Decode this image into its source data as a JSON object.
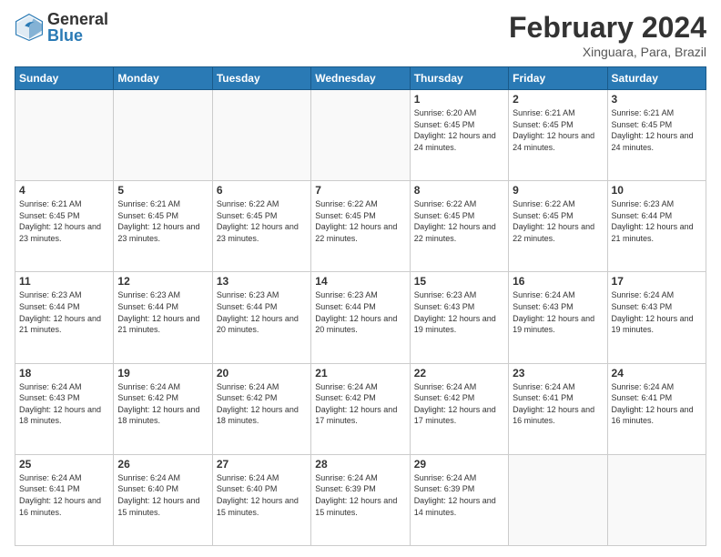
{
  "logo": {
    "general": "General",
    "blue": "Blue"
  },
  "title": {
    "month_year": "February 2024",
    "location": "Xinguara, Para, Brazil"
  },
  "weekdays": [
    "Sunday",
    "Monday",
    "Tuesday",
    "Wednesday",
    "Thursday",
    "Friday",
    "Saturday"
  ],
  "weeks": [
    [
      {
        "day": "",
        "info": ""
      },
      {
        "day": "",
        "info": ""
      },
      {
        "day": "",
        "info": ""
      },
      {
        "day": "",
        "info": ""
      },
      {
        "day": "1",
        "info": "Sunrise: 6:20 AM\nSunset: 6:45 PM\nDaylight: 12 hours and 24 minutes."
      },
      {
        "day": "2",
        "info": "Sunrise: 6:21 AM\nSunset: 6:45 PM\nDaylight: 12 hours and 24 minutes."
      },
      {
        "day": "3",
        "info": "Sunrise: 6:21 AM\nSunset: 6:45 PM\nDaylight: 12 hours and 24 minutes."
      }
    ],
    [
      {
        "day": "4",
        "info": "Sunrise: 6:21 AM\nSunset: 6:45 PM\nDaylight: 12 hours and 23 minutes."
      },
      {
        "day": "5",
        "info": "Sunrise: 6:21 AM\nSunset: 6:45 PM\nDaylight: 12 hours and 23 minutes."
      },
      {
        "day": "6",
        "info": "Sunrise: 6:22 AM\nSunset: 6:45 PM\nDaylight: 12 hours and 23 minutes."
      },
      {
        "day": "7",
        "info": "Sunrise: 6:22 AM\nSunset: 6:45 PM\nDaylight: 12 hours and 22 minutes."
      },
      {
        "day": "8",
        "info": "Sunrise: 6:22 AM\nSunset: 6:45 PM\nDaylight: 12 hours and 22 minutes."
      },
      {
        "day": "9",
        "info": "Sunrise: 6:22 AM\nSunset: 6:45 PM\nDaylight: 12 hours and 22 minutes."
      },
      {
        "day": "10",
        "info": "Sunrise: 6:23 AM\nSunset: 6:44 PM\nDaylight: 12 hours and 21 minutes."
      }
    ],
    [
      {
        "day": "11",
        "info": "Sunrise: 6:23 AM\nSunset: 6:44 PM\nDaylight: 12 hours and 21 minutes."
      },
      {
        "day": "12",
        "info": "Sunrise: 6:23 AM\nSunset: 6:44 PM\nDaylight: 12 hours and 21 minutes."
      },
      {
        "day": "13",
        "info": "Sunrise: 6:23 AM\nSunset: 6:44 PM\nDaylight: 12 hours and 20 minutes."
      },
      {
        "day": "14",
        "info": "Sunrise: 6:23 AM\nSunset: 6:44 PM\nDaylight: 12 hours and 20 minutes."
      },
      {
        "day": "15",
        "info": "Sunrise: 6:23 AM\nSunset: 6:43 PM\nDaylight: 12 hours and 19 minutes."
      },
      {
        "day": "16",
        "info": "Sunrise: 6:24 AM\nSunset: 6:43 PM\nDaylight: 12 hours and 19 minutes."
      },
      {
        "day": "17",
        "info": "Sunrise: 6:24 AM\nSunset: 6:43 PM\nDaylight: 12 hours and 19 minutes."
      }
    ],
    [
      {
        "day": "18",
        "info": "Sunrise: 6:24 AM\nSunset: 6:43 PM\nDaylight: 12 hours and 18 minutes."
      },
      {
        "day": "19",
        "info": "Sunrise: 6:24 AM\nSunset: 6:42 PM\nDaylight: 12 hours and 18 minutes."
      },
      {
        "day": "20",
        "info": "Sunrise: 6:24 AM\nSunset: 6:42 PM\nDaylight: 12 hours and 18 minutes."
      },
      {
        "day": "21",
        "info": "Sunrise: 6:24 AM\nSunset: 6:42 PM\nDaylight: 12 hours and 17 minutes."
      },
      {
        "day": "22",
        "info": "Sunrise: 6:24 AM\nSunset: 6:42 PM\nDaylight: 12 hours and 17 minutes."
      },
      {
        "day": "23",
        "info": "Sunrise: 6:24 AM\nSunset: 6:41 PM\nDaylight: 12 hours and 16 minutes."
      },
      {
        "day": "24",
        "info": "Sunrise: 6:24 AM\nSunset: 6:41 PM\nDaylight: 12 hours and 16 minutes."
      }
    ],
    [
      {
        "day": "25",
        "info": "Sunrise: 6:24 AM\nSunset: 6:41 PM\nDaylight: 12 hours and 16 minutes."
      },
      {
        "day": "26",
        "info": "Sunrise: 6:24 AM\nSunset: 6:40 PM\nDaylight: 12 hours and 15 minutes."
      },
      {
        "day": "27",
        "info": "Sunrise: 6:24 AM\nSunset: 6:40 PM\nDaylight: 12 hours and 15 minutes."
      },
      {
        "day": "28",
        "info": "Sunrise: 6:24 AM\nSunset: 6:39 PM\nDaylight: 12 hours and 15 minutes."
      },
      {
        "day": "29",
        "info": "Sunrise: 6:24 AM\nSunset: 6:39 PM\nDaylight: 12 hours and 14 minutes."
      },
      {
        "day": "",
        "info": ""
      },
      {
        "day": "",
        "info": ""
      }
    ]
  ]
}
